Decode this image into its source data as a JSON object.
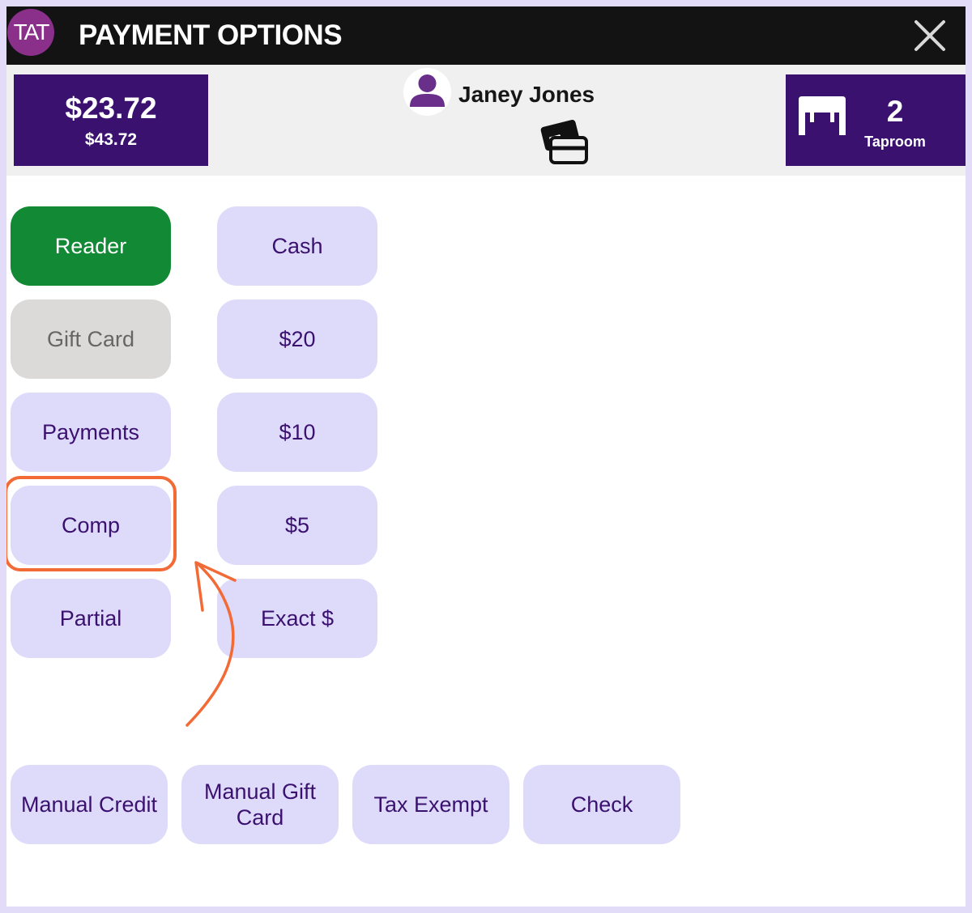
{
  "header": {
    "logo_text": "TAT",
    "title": "PAYMENT OPTIONS",
    "close_icon": "close-icon"
  },
  "summary": {
    "total": "$23.72",
    "subtotal": "$43.72",
    "customer_name": "Janey Jones",
    "avatar_icon": "user-avatar-icon",
    "cards_icon": "saved-cards-icon",
    "table_number": "2",
    "table_area": "Taproom",
    "table_icon": "table-icon"
  },
  "payment_options": {
    "left_column": [
      "Reader",
      "Gift Card",
      "Payments",
      "Comp",
      "Partial"
    ],
    "right_column": [
      "Cash",
      "$20",
      "$10",
      "$5",
      "Exact $"
    ],
    "bottom_row": [
      "Manual Credit",
      "Manual Gift Card",
      "Tax Exempt",
      "Check"
    ]
  },
  "annotation": {
    "highlighted_option": "Comp",
    "highlight_color": "#f26a36"
  },
  "colors": {
    "header_bg": "#131313",
    "brand_purple": "#3b1170",
    "logo_magenta": "#8a2f8a",
    "button_lavender": "#dedaf9",
    "reader_green": "#128934",
    "disabled_gray": "#dcdad8",
    "page_border": "#e2dcf8"
  }
}
